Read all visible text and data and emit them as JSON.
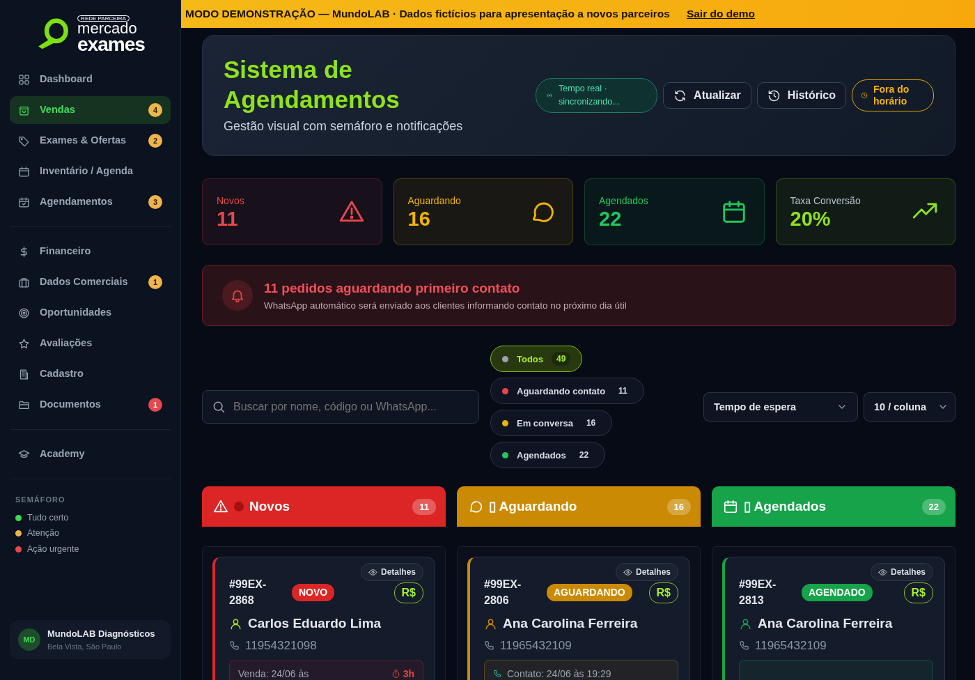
{
  "banner": {
    "text": "MODO DEMONSTRAÇÃO — MundoLAB · Dados fictícios para apresentação a novos parceiros",
    "link": "Sair do demo"
  },
  "sidebar": {
    "logo": {
      "tag": "REDE PARCEIRA",
      "line1": "mercado",
      "line2": "exames"
    },
    "sections": [
      {
        "items": [
          {
            "label": "Dashboard",
            "selected": false
          },
          {
            "label": "Vendas",
            "selected": true,
            "badge": "4",
            "color": "#f0b44c"
          },
          {
            "label": "Exames & Ofertas",
            "selected": false,
            "badge": "2",
            "color": "#f0b44c"
          },
          {
            "label": "Inventário / Agenda",
            "selected": false
          },
          {
            "label": "Agendamentos",
            "selected": false,
            "badge": "3",
            "color": "#f0b44c"
          }
        ]
      },
      {
        "items": [
          {
            "label": "Financeiro",
            "selected": false
          },
          {
            "label": "Dados Comerciais",
            "selected": false,
            "badge": "1",
            "color": "#f0b44c"
          },
          {
            "label": "Oportunidades",
            "selected": false
          },
          {
            "label": "Avaliações",
            "selected": false
          },
          {
            "label": "Cadastro",
            "selected": false
          },
          {
            "label": "Documentos",
            "selected": false,
            "badge": "1",
            "color": "#e5484d"
          }
        ]
      },
      {
        "items": [
          {
            "label": "Academy",
            "selected": false
          }
        ]
      }
    ],
    "legend": {
      "title": "SEMÁFORO",
      "items": [
        {
          "label": "Tudo certo",
          "color": "#3ddc4f"
        },
        {
          "label": "Atenção",
          "color": "#f0b44c"
        },
        {
          "label": "Ação urgente",
          "color": "#e5484d"
        }
      ]
    },
    "user": {
      "initials": "MD",
      "name": "MundoLAB Diagnósticos",
      "location": "Bela Vista, São Paulo"
    }
  },
  "header": {
    "title": "Sistema de Agendamentos",
    "subtitle": "Gestão visual com semáforo e notificações",
    "status": "Tempo real · sincronizando...",
    "buttons": [
      {
        "label": "Atualizar"
      },
      {
        "label": "Histórico"
      }
    ],
    "off_hours": "Fora do horário"
  },
  "stats": [
    {
      "label": "Novos",
      "value": "11",
      "color": "#e5484d"
    },
    {
      "label": "Aguardando",
      "value": "16",
      "color": "#f0b400"
    },
    {
      "label": "Agendados",
      "value": "22",
      "color": "#22c55e"
    },
    {
      "label": "Taxa Conversão",
      "value": "20%",
      "color": "#8ee21d"
    }
  ],
  "alert": {
    "title": "11 pedidos aguardando primeiro contato",
    "message": "WhatsApp automático será enviado aos clientes informando contato no próximo dia útil"
  },
  "search": {
    "placeholder": "Buscar por nome, código ou WhatsApp..."
  },
  "filters": [
    {
      "label": "Todos",
      "count": "49",
      "color": "#9ca3af",
      "selected": true
    },
    {
      "label": "Aguardando contato",
      "count": "11",
      "color": "#ef4444",
      "selected": false
    },
    {
      "label": "Em conversa",
      "count": "16",
      "color": "#eab308",
      "selected": false
    },
    {
      "label": "Agendados",
      "count": "22",
      "color": "#22c55e",
      "selected": false
    }
  ],
  "selects": [
    {
      "value": "Tempo de espera"
    },
    {
      "value": "10 / coluna"
    }
  ],
  "columns": [
    {
      "title": "Novos",
      "count": "11",
      "color": "#dc2626",
      "cards": [
        {
          "code": "#99EX-2868",
          "status": "NOVO",
          "price": "R$",
          "action": "Detalhes",
          "name": "Carlos Eduardo Lima",
          "phone": "11954321098",
          "footer": "Venda: 24/06 às",
          "timer": "3h"
        }
      ]
    },
    {
      "title": "▯ Aguardando",
      "count": "16",
      "color": "#ca8a04",
      "cards": [
        {
          "code": "#99EX-2806",
          "status": "AGUARDANDO",
          "price": "R$",
          "action": "Detalhes",
          "name": "Ana Carolina Ferreira",
          "phone": "11965432109",
          "footer": "Contato: 24/06 às 19:29"
        }
      ]
    },
    {
      "title": "▯ Agendados",
      "count": "22",
      "color": "#16a34a",
      "cards": [
        {
          "code": "#99EX-2813",
          "status": "AGENDADO",
          "price": "R$",
          "action": "Detalhes",
          "name": "Ana Carolina Ferreira",
          "phone": "11965432109"
        }
      ]
    }
  ]
}
